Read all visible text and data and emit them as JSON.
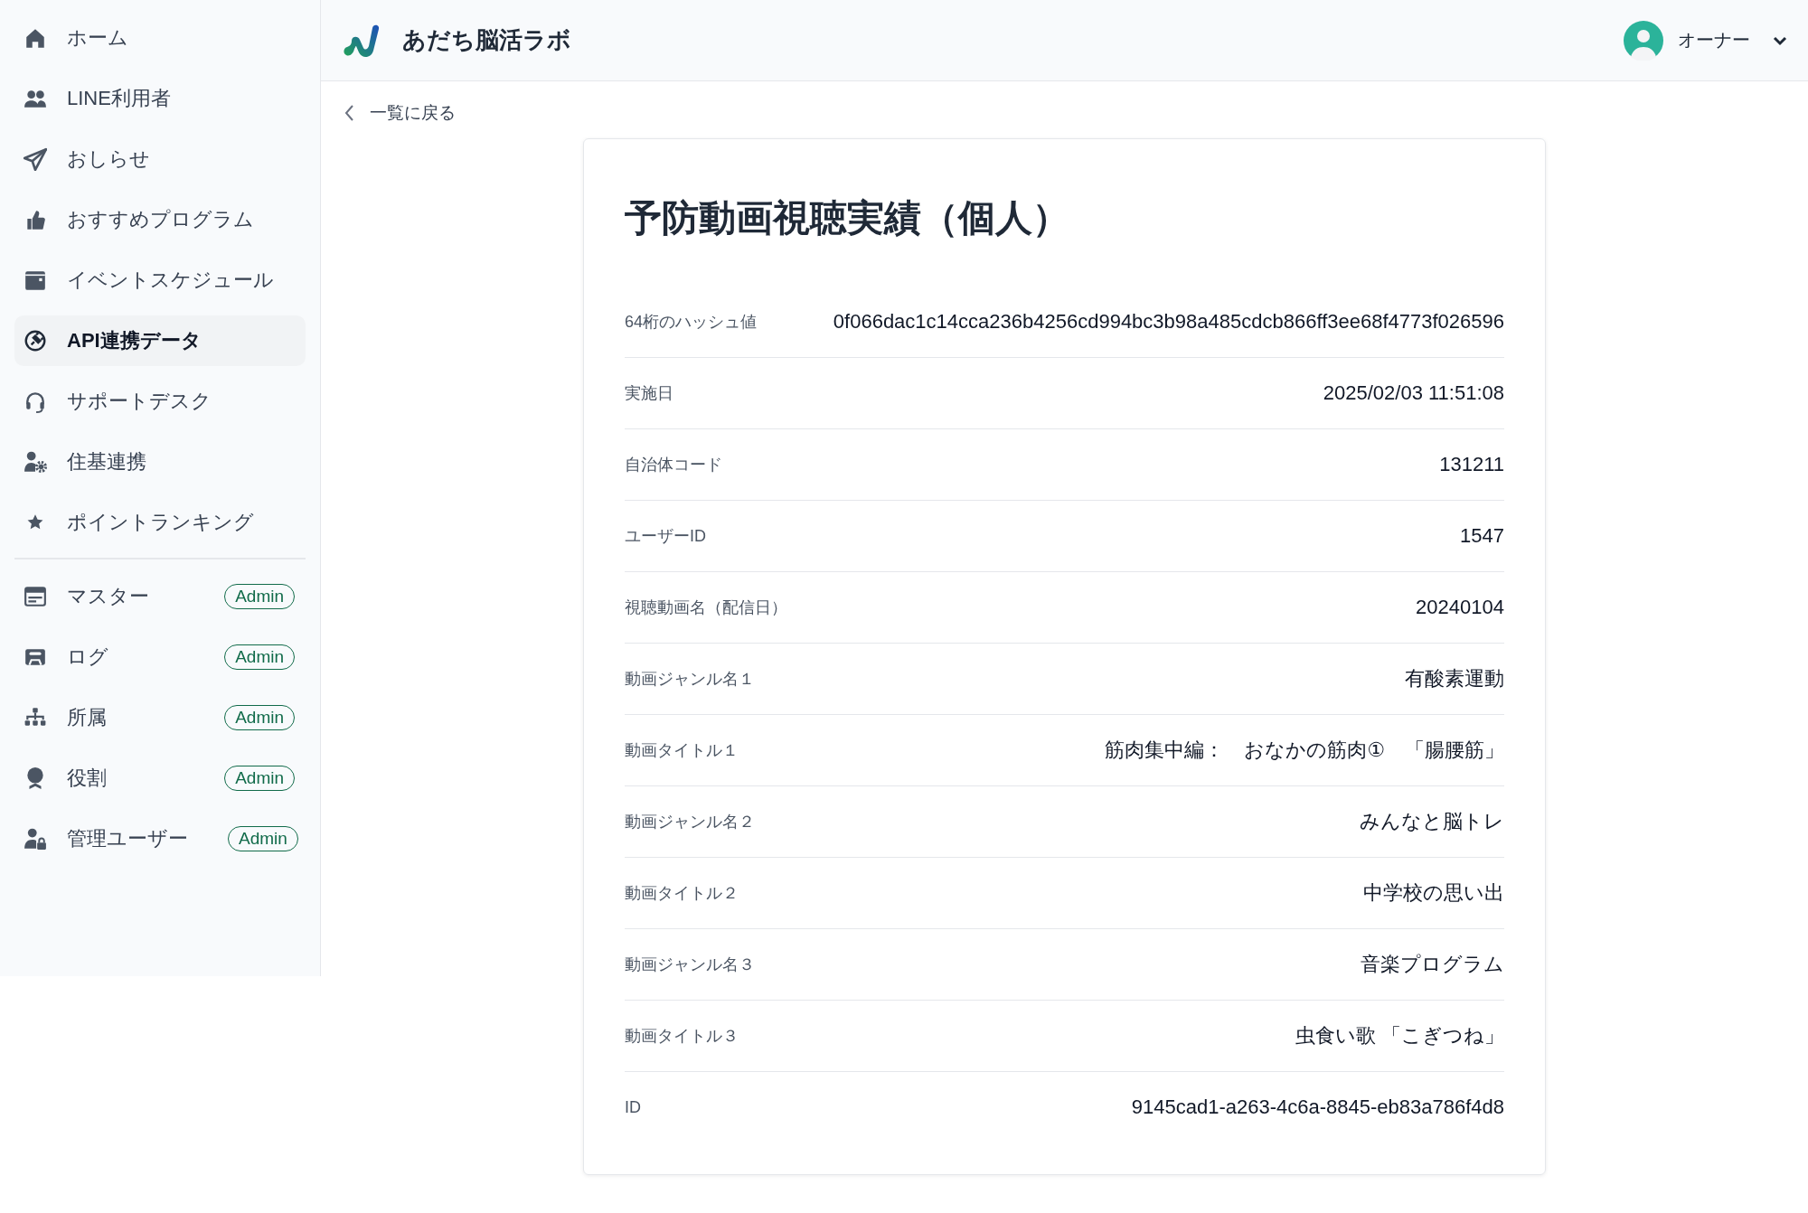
{
  "sidebar": {
    "items": [
      {
        "label": "ホーム",
        "selected": false
      },
      {
        "label": "LINE利用者",
        "selected": false
      },
      {
        "label": "おしらせ",
        "selected": false
      },
      {
        "label": "おすすめプログラム",
        "selected": false
      },
      {
        "label": "イベントスケジュール",
        "selected": false
      },
      {
        "label": "API連携データ",
        "selected": true
      },
      {
        "label": "サポートデスク",
        "selected": false
      },
      {
        "label": "住基連携",
        "selected": false
      },
      {
        "label": "ポイントランキング",
        "selected": false
      }
    ],
    "admin_items": [
      {
        "label": "マスター",
        "badge": "Admin",
        "selected": false
      },
      {
        "label": "ログ",
        "badge": "Admin",
        "selected": false
      },
      {
        "label": "所属",
        "badge": "Admin",
        "selected": false
      },
      {
        "label": "役割",
        "badge": "Admin",
        "selected": false
      },
      {
        "label": "管理ユーザー",
        "badge": "Admin",
        "selected": false
      }
    ]
  },
  "header": {
    "app_name": "あだち脳活ラボ",
    "user": "オーナー"
  },
  "back_link": "一覧に戻る",
  "card": {
    "title": "予防動画視聴実績（個人）",
    "rows": [
      {
        "label": "64桁のハッシュ値",
        "value": "0f066dac1c14cca236b4256cd994bc3b98a485cdcb866ff3ee68f4773f026596"
      },
      {
        "label": "実施日",
        "value": "2025/02/03 11:51:08"
      },
      {
        "label": "自治体コード",
        "value": "131211"
      },
      {
        "label": "ユーザーID",
        "value": "1547"
      },
      {
        "label": "視聴動画名（配信日）",
        "value": "20240104"
      },
      {
        "label": "動画ジャンル名１",
        "value": "有酸素運動"
      },
      {
        "label": "動画タイトル１",
        "value": "筋肉集中編：　おなかの筋肉①　「腸腰筋」"
      },
      {
        "label": "動画ジャンル名２",
        "value": "みんなと脳トレ"
      },
      {
        "label": "動画タイトル２",
        "value": "中学校の思い出"
      },
      {
        "label": "動画ジャンル名３",
        "value": "音楽プログラム"
      },
      {
        "label": "動画タイトル３",
        "value": "虫食い歌 「こぎつね」"
      },
      {
        "label": "ID",
        "value": "9145cad1-a263-4c6a-8845-eb83a786f4d8"
      }
    ]
  }
}
